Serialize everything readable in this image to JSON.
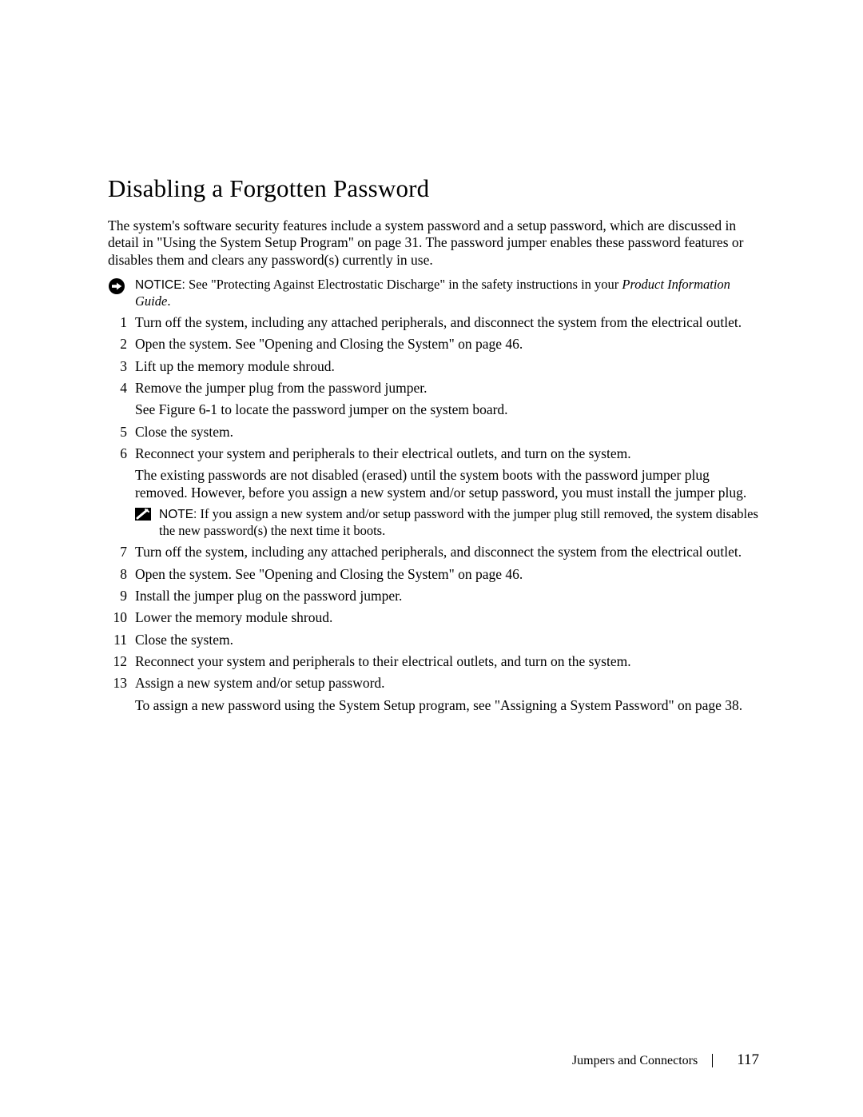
{
  "heading": "Disabling a Forgotten Password",
  "intro": "The system's software security features include a system password and a setup password, which are discussed in detail in \"Using the System Setup Program\" on page 31. The password jumper enables these password features or disables them and clears any password(s) currently in use.",
  "notice": {
    "label": "NOTICE:",
    "text_before_italic": " See \"Protecting Against Electrostatic Discharge\" in the safety instructions in your ",
    "italic": "Product Information Guide",
    "after": "."
  },
  "steps": {
    "s1": "Turn off the system, including any attached peripherals, and disconnect the system from the electrical outlet.",
    "s2": "Open the system. See \"Opening and Closing the System\" on page 46.",
    "s3": "Lift up the memory module shroud.",
    "s4": "Remove the jumper plug from the password jumper.",
    "s4_sub": "See Figure 6-1 to locate the password jumper on the system board.",
    "s5": "Close the system.",
    "s6": "Reconnect your system and peripherals to their electrical outlets, and turn on the system.",
    "s6_sub": "The existing passwords are not disabled (erased) until the system boots with the password jumper plug removed. However, before you assign a new system and/or setup password, you must install the jumper plug.",
    "s6_note_label": "NOTE:",
    "s6_note_text": " If you assign a new system and/or setup password with the jumper plug still removed, the system disables the new password(s) the next time it boots.",
    "s7": "Turn off the system, including any attached peripherals, and disconnect the system from the electrical outlet.",
    "s8": "Open the system. See \"Opening and Closing the System\" on page 46.",
    "s9": "Install the jumper plug on the password jumper.",
    "s10": "Lower the memory module shroud.",
    "s11": "Close the system.",
    "s12": "Reconnect your system and peripherals to their electrical outlets, and turn on the system.",
    "s13": "Assign a new system and/or setup password.",
    "s13_sub": "To assign a new password using the System Setup program, see \"Assigning a System Password\" on page 38."
  },
  "footer": {
    "section": "Jumpers and Connectors",
    "page": "117"
  }
}
